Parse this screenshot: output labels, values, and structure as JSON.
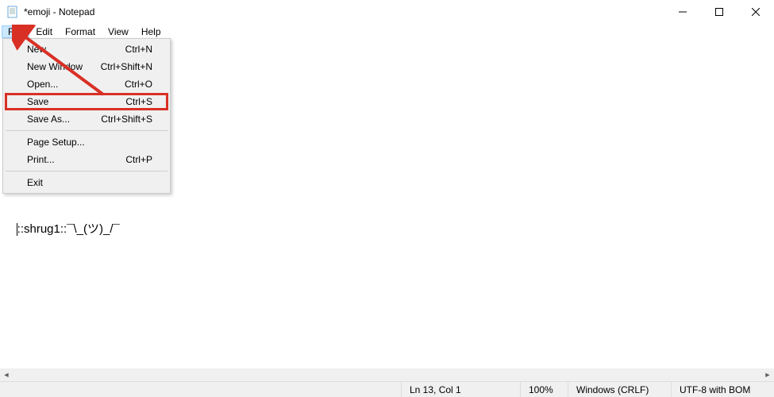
{
  "title": "*emoji  - Notepad",
  "menuBar": {
    "file": "File",
    "edit": "Edit",
    "format": "Format",
    "view": "View",
    "help": "Help"
  },
  "fileMenu": {
    "new": {
      "label": "New",
      "shortcut": "Ctrl+N"
    },
    "newWindow": {
      "label": "New Window",
      "shortcut": "Ctrl+Shift+N"
    },
    "open": {
      "label": "Open...",
      "shortcut": "Ctrl+O"
    },
    "save": {
      "label": "Save",
      "shortcut": "Ctrl+S"
    },
    "saveAs": {
      "label": "Save As...",
      "shortcut": "Ctrl+Shift+S"
    },
    "pageSetup": {
      "label": "Page Setup...",
      "shortcut": ""
    },
    "print": {
      "label": "Print...",
      "shortcut": "Ctrl+P"
    },
    "exit": {
      "label": "Exit",
      "shortcut": ""
    }
  },
  "editorContent": "::shrug1::¯\\_(ツ)_/¯",
  "statusBar": {
    "position": "Ln 13, Col 1",
    "zoom": "100%",
    "lineEnding": "Windows (CRLF)",
    "encoding": "UTF-8 with BOM"
  }
}
